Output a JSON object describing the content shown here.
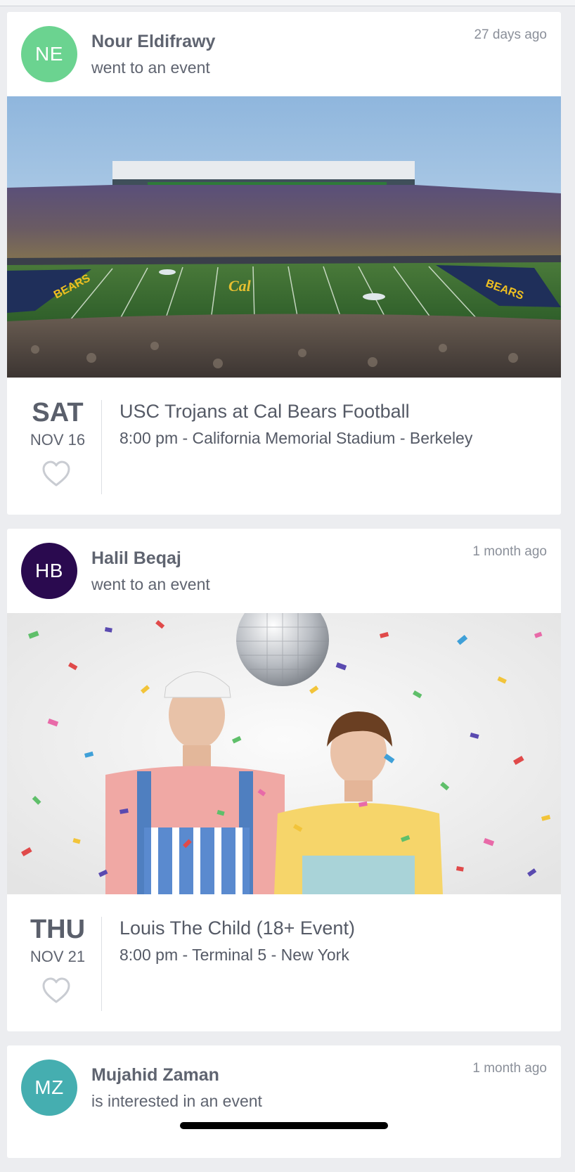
{
  "feed": {
    "cards": [
      {
        "user_initials": "NE",
        "user_name": "Nour Eldifrawy",
        "action": "went to an event",
        "time_ago": "27 days ago",
        "avatar_color": "#6bd390",
        "event": {
          "day": "SAT",
          "date": "NOV 16",
          "title": "USC Trojans at Cal Bears Football",
          "details": "8:00 pm - California Memorial Stadium - Berkeley",
          "liked": false
        }
      },
      {
        "user_initials": "HB",
        "user_name": "Halil Beqaj",
        "action": "went to an event",
        "time_ago": "1 month ago",
        "avatar_color": "#2a0a4f",
        "event": {
          "day": "THU",
          "date": "NOV 21",
          "title": "Louis The Child (18+ Event)",
          "details": "8:00 pm - Terminal 5 - New York",
          "liked": false
        }
      },
      {
        "user_initials": "MZ",
        "user_name": "Mujahid Zaman",
        "action": "is interested in an event",
        "time_ago": "1 month ago",
        "avatar_color": "#45aeb0"
      }
    ]
  },
  "icons": {
    "like": "heart-outline-icon"
  },
  "colors": {
    "background": "#ecedf0",
    "card": "#ffffff",
    "text": "#555a66",
    "muted": "#8a8f99"
  }
}
